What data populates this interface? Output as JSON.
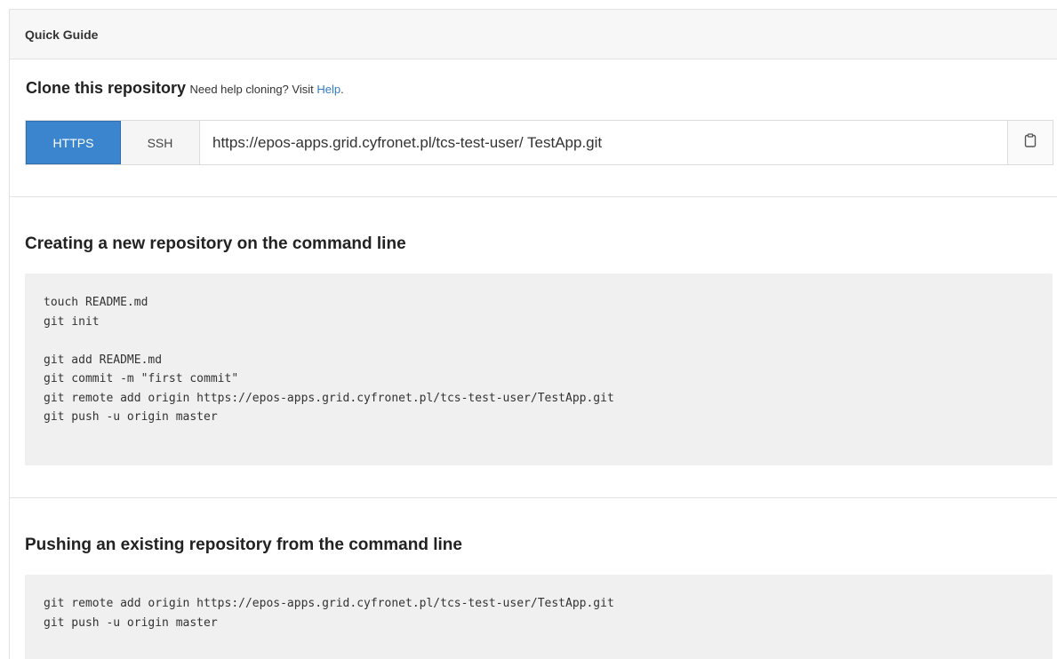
{
  "panel": {
    "heading": "Quick Guide"
  },
  "clone": {
    "title": "Clone this repository",
    "help_prefix": "Need help cloning? Visit",
    "help_link": "Help",
    "help_suffix": ".",
    "protocols": {
      "https_label": "HTTPS",
      "ssh_label": "SSH",
      "selected": "HTTPS"
    },
    "url": "https://epos-apps.grid.cyfronet.pl/tcs-test-user/ TestApp.git"
  },
  "create_section": {
    "title": "Creating a new repository on the command line",
    "lines": [
      "touch README.md",
      "git init",
      "",
      "git add README.md",
      "git commit -m \"first commit\"",
      "git remote add origin https://epos-apps.grid.cyfronet.pl/tcs-test-user/TestApp.git",
      "git push -u origin master"
    ]
  },
  "push_section": {
    "title": "Pushing an existing repository from the command line",
    "lines": [
      "git remote add origin https://epos-apps.grid.cyfronet.pl/tcs-test-user/TestApp.git",
      "git push -u origin master"
    ]
  },
  "colors": {
    "accent": "#3a85cd",
    "link": "#2f7dc3",
    "code_bg": "#f0f0f0"
  },
  "icons": {
    "copy": "clipboard-icon"
  }
}
